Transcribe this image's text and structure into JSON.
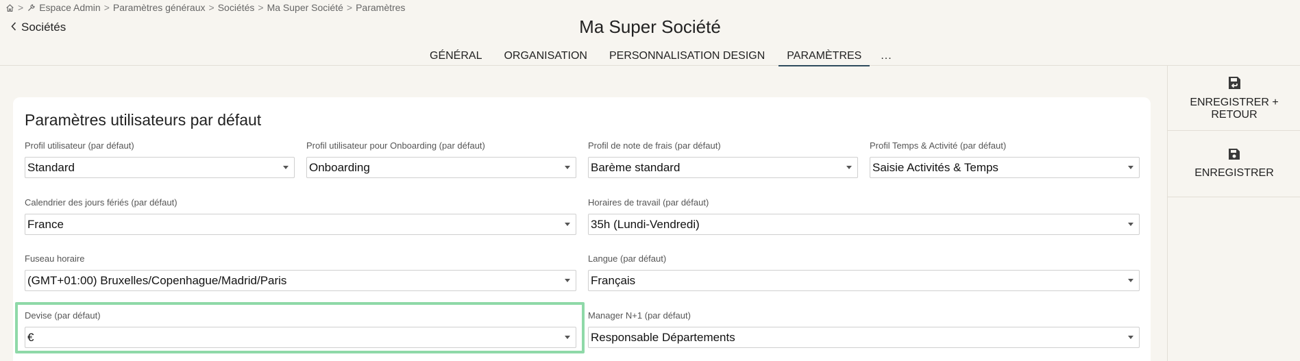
{
  "breadcrumb": {
    "items": [
      "Espace Admin",
      "Paramètres généraux",
      "Sociétés",
      "Ma Super Société",
      "Paramètres"
    ],
    "separator": ">"
  },
  "back_link": {
    "label": "Sociétés"
  },
  "page_title": "Ma Super Société",
  "tabs": [
    {
      "label": "GÉNÉRAL",
      "active": false
    },
    {
      "label": "ORGANISATION",
      "active": false
    },
    {
      "label": "PERSONNALISATION DESIGN",
      "active": false
    },
    {
      "label": "PARAMÈTRES",
      "active": true
    },
    {
      "label": "...",
      "active": false
    }
  ],
  "card": {
    "title": "Paramètres utilisateurs par défaut",
    "fields": {
      "user_profile": {
        "label": "Profil utilisateur (par défaut)",
        "value": "Standard"
      },
      "onboarding_profile": {
        "label": "Profil utilisateur pour Onboarding (par défaut)",
        "value": "Onboarding"
      },
      "expense_profile": {
        "label": "Profil de note de frais (par défaut)",
        "value": "Barème standard"
      },
      "time_profile": {
        "label": "Profil Temps & Activité (par défaut)",
        "value": "Saisie Activités & Temps"
      },
      "holiday_calendar": {
        "label": "Calendrier des jours fériés (par défaut)",
        "value": "France"
      },
      "work_hours": {
        "label": "Horaires de travail (par défaut)",
        "value": "35h (Lundi-Vendredi)"
      },
      "timezone": {
        "label": "Fuseau horaire",
        "value": "(GMT+01:00) Bruxelles/Copenhague/Madrid/Paris"
      },
      "language": {
        "label": "Langue (par défaut)",
        "value": "Français"
      },
      "currency": {
        "label": "Devise (par défaut)",
        "value": "€"
      },
      "manager": {
        "label": "Manager N+1 (par défaut)",
        "value": "Responsable Départements"
      }
    }
  },
  "actions": {
    "save_return": {
      "line1": "ENREGISTRER +",
      "line2": "RETOUR",
      "icon": "save-return-icon"
    },
    "save": {
      "label": "ENREGISTRER",
      "icon": "save-icon"
    }
  },
  "colors": {
    "background": "#f7f5f0",
    "active_tab_underline": "#2d4a5c",
    "highlight": "#8fd9a8"
  }
}
